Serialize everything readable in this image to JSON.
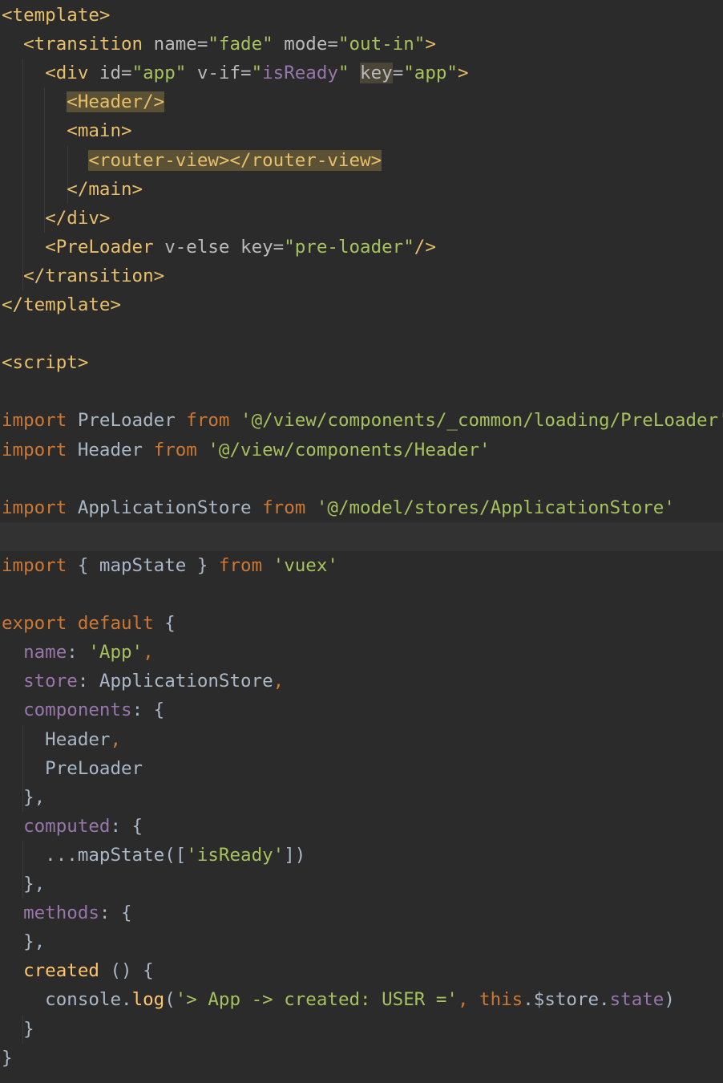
{
  "editor": {
    "language": "vue",
    "colors": {
      "background": "#2b2b2b",
      "tag": "#e8bf6a",
      "string": "#a5c25c",
      "keyword": "#cc7832",
      "property": "#9876aa",
      "identifier": "#a9b7c6",
      "highlight": "#5b5236"
    },
    "lines": [
      [
        {
          "t": "<template>",
          "c": "tag"
        }
      ],
      [
        {
          "t": "  "
        },
        {
          "t": "<transition",
          "c": "tag"
        },
        {
          "t": " name=",
          "c": "attr"
        },
        {
          "t": "\"fade\"",
          "c": "str"
        },
        {
          "t": " mode=",
          "c": "attr"
        },
        {
          "t": "\"out-in\"",
          "c": "str"
        },
        {
          "t": ">",
          "c": "tag"
        }
      ],
      [
        {
          "t": "    "
        },
        {
          "t": "<div",
          "c": "tag"
        },
        {
          "t": " id=",
          "c": "attr"
        },
        {
          "t": "\"app\"",
          "c": "str"
        },
        {
          "t": " v-if=",
          "c": "attr"
        },
        {
          "t": "\"",
          "c": "str"
        },
        {
          "t": "isReady",
          "c": "prop"
        },
        {
          "t": "\"",
          "c": "str"
        },
        {
          "t": " "
        },
        {
          "t": "key",
          "c": "attr",
          "h": "hk"
        },
        {
          "t": "=",
          "c": "attr"
        },
        {
          "t": "\"app\"",
          "c": "str"
        },
        {
          "t": ">",
          "c": "tag"
        }
      ],
      [
        {
          "t": "      "
        },
        {
          "t": "<Header/>",
          "c": "tag",
          "h": "hl"
        }
      ],
      [
        {
          "t": "      "
        },
        {
          "t": "<main>",
          "c": "tag"
        }
      ],
      [
        {
          "t": "        "
        },
        {
          "t": "<router-view></router-view>",
          "c": "tag",
          "h": "hl"
        }
      ],
      [
        {
          "t": "      "
        },
        {
          "t": "</main>",
          "c": "tag"
        }
      ],
      [
        {
          "t": "    "
        },
        {
          "t": "</div>",
          "c": "tag"
        }
      ],
      [
        {
          "t": "    "
        },
        {
          "t": "<PreLoader",
          "c": "tag"
        },
        {
          "t": " v-else key=",
          "c": "attr"
        },
        {
          "t": "\"pre-loader\"",
          "c": "str"
        },
        {
          "t": "/>",
          "c": "tag"
        }
      ],
      [
        {
          "t": "  "
        },
        {
          "t": "</transition>",
          "c": "tag"
        }
      ],
      [
        {
          "t": "</template>",
          "c": "tag"
        }
      ],
      [],
      [
        {
          "t": "<script>",
          "c": "tag"
        }
      ],
      [],
      [
        {
          "t": "import",
          "c": "kw"
        },
        {
          "t": " PreLoader ",
          "c": "id"
        },
        {
          "t": "from",
          "c": "kw"
        },
        {
          "t": " "
        },
        {
          "t": "'@/view/components/_common/loading/PreLoader'",
          "c": "str"
        }
      ],
      [
        {
          "t": "import",
          "c": "kw"
        },
        {
          "t": " Header ",
          "c": "id"
        },
        {
          "t": "from",
          "c": "kw"
        },
        {
          "t": " "
        },
        {
          "t": "'@/view/components/Header'",
          "c": "str"
        }
      ],
      [],
      [
        {
          "t": "import",
          "c": "kw"
        },
        {
          "t": " ApplicationStore ",
          "c": "id"
        },
        {
          "t": "from",
          "c": "kw"
        },
        {
          "t": " "
        },
        {
          "t": "'@/model/stores/ApplicationStore'",
          "c": "str"
        }
      ],
      [],
      [
        {
          "t": "import",
          "c": "kw"
        },
        {
          "t": " { mapState } ",
          "c": "id"
        },
        {
          "t": "from",
          "c": "kw"
        },
        {
          "t": " "
        },
        {
          "t": "'vuex'",
          "c": "str"
        }
      ],
      [],
      [
        {
          "t": "export",
          "c": "kw"
        },
        {
          "t": " "
        },
        {
          "t": "default",
          "c": "kw"
        },
        {
          "t": " {",
          "c": "id"
        }
      ],
      [
        {
          "t": "  "
        },
        {
          "t": "name",
          "c": "prop"
        },
        {
          "t": ": ",
          "c": "id"
        },
        {
          "t": "'App'",
          "c": "str"
        },
        {
          "t": ",",
          "c": "punc"
        }
      ],
      [
        {
          "t": "  "
        },
        {
          "t": "store",
          "c": "prop"
        },
        {
          "t": ": ApplicationStore",
          "c": "id"
        },
        {
          "t": ",",
          "c": "punc"
        }
      ],
      [
        {
          "t": "  "
        },
        {
          "t": "components",
          "c": "prop"
        },
        {
          "t": ": {",
          "c": "id"
        }
      ],
      [
        {
          "t": "    Header",
          "c": "id"
        },
        {
          "t": ",",
          "c": "punc"
        }
      ],
      [
        {
          "t": "    PreLoader",
          "c": "id"
        }
      ],
      [
        {
          "t": "  },",
          "c": "id"
        }
      ],
      [
        {
          "t": "  "
        },
        {
          "t": "computed",
          "c": "prop"
        },
        {
          "t": ": {",
          "c": "id"
        }
      ],
      [
        {
          "t": "    ...mapState([",
          "c": "id"
        },
        {
          "t": "'isReady'",
          "c": "str"
        },
        {
          "t": "])",
          "c": "id"
        }
      ],
      [
        {
          "t": "  },",
          "c": "id"
        }
      ],
      [
        {
          "t": "  "
        },
        {
          "t": "methods",
          "c": "prop"
        },
        {
          "t": ": {",
          "c": "id"
        }
      ],
      [
        {
          "t": "  },",
          "c": "id"
        }
      ],
      [
        {
          "t": "  "
        },
        {
          "t": "created",
          "c": "method"
        },
        {
          "t": " () {",
          "c": "id"
        }
      ],
      [
        {
          "t": "    console.",
          "c": "id"
        },
        {
          "t": "log",
          "c": "method"
        },
        {
          "t": "(",
          "c": "id"
        },
        {
          "t": "'> App -> created: USER ='",
          "c": "str"
        },
        {
          "t": ", ",
          "c": "punc"
        },
        {
          "t": "this",
          "c": "kw"
        },
        {
          "t": ".$store.",
          "c": "id"
        },
        {
          "t": "state",
          "c": "prop"
        },
        {
          "t": ")",
          "c": "id"
        }
      ],
      [
        {
          "t": "  }",
          "c": "id"
        }
      ],
      [
        {
          "t": "}",
          "c": "id"
        }
      ]
    ]
  }
}
